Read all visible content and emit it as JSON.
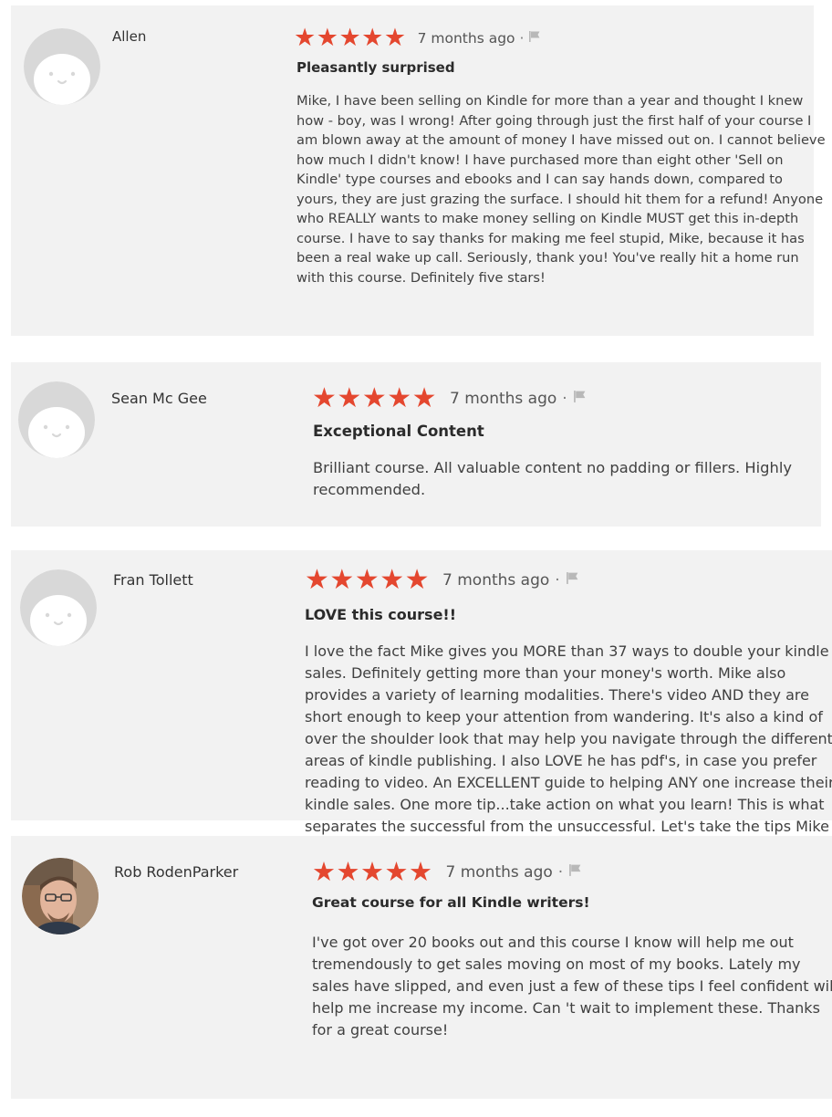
{
  "reviews": [
    {
      "name": "Allen",
      "rating": 5,
      "stars": [
        "★",
        "★",
        "★",
        "★",
        "★"
      ],
      "time": "7 months ago",
      "separator": "·",
      "flag_icon": "flag-icon",
      "avatar_icon": "default-face-avatar",
      "title": "Pleasantly surprised",
      "body": "Mike, I have been selling on Kindle for more than a year and thought I knew how - boy, was I wrong! After going through just the first half of your course I am blown away at the amount of money I have missed out on. I cannot believe how much I didn't know! I have purchased more than eight other 'Sell on Kindle' type courses and ebooks and I can say hands down, compared to yours, they are just grazing the surface. I should hit them for a refund! Anyone who REALLY wants to make money selling on Kindle MUST get this in-depth course. I have to say thanks for making me feel stupid, Mike, because it has been a real wake up call. Seriously, thank you! You've really hit a home run with this course. Definitely five stars!"
    },
    {
      "name": "Sean Mc Gee",
      "rating": 5,
      "stars": [
        "★",
        "★",
        "★",
        "★",
        "★"
      ],
      "time": "7 months ago",
      "separator": "·",
      "flag_icon": "flag-icon",
      "avatar_icon": "default-face-avatar",
      "title": "Exceptional Content",
      "body": "Brilliant course. All valuable content no padding or fillers. Highly recommended."
    },
    {
      "name": "Fran Tollett",
      "rating": 5,
      "stars": [
        "★",
        "★",
        "★",
        "★",
        "★"
      ],
      "time": "7 months ago",
      "separator": "·",
      "flag_icon": "flag-icon",
      "avatar_icon": "default-face-avatar",
      "title": "LOVE this course!!",
      "body": "I love the fact Mike gives you MORE than 37 ways to double your kindle sales. Definitely getting more than your money's worth. Mike also provides a variety of learning modalities. There's video AND they are short enough to keep your attention from wandering. It's also a kind of over the shoulder look that may help you navigate through the different areas of kindle publishing. I also LOVE he has pdf's, in case you prefer reading to video. An EXCELLENT guide to helping ANY one increase their kindle sales. One more tip...take action on what you learn! This is what separates the successful from the unsuccessful. Let's take the tips Mike shares and change our world."
    },
    {
      "name": "Rob RodenParker",
      "rating": 5,
      "stars": [
        "★",
        "★",
        "★",
        "★",
        "★"
      ],
      "time": "7 months ago",
      "separator": "·",
      "flag_icon": "flag-icon",
      "avatar_icon": "user-photo-avatar",
      "title": "Great course for all Kindle writers!",
      "body": "I've got over 20 books out and this course I know will help me out tremendously to get sales moving on most of my books. Lately my sales have slipped, and even just a few of these tips I feel confident will help me increase my income. Can 't wait to implement these. Thanks for a great course!"
    }
  ],
  "colors": {
    "card_bg": "#f2f2f2",
    "star": "#e4472f",
    "flag": "#b8b8b8",
    "avatar_bg": "#d8d8d8",
    "avatar_face": "#ffffff"
  }
}
